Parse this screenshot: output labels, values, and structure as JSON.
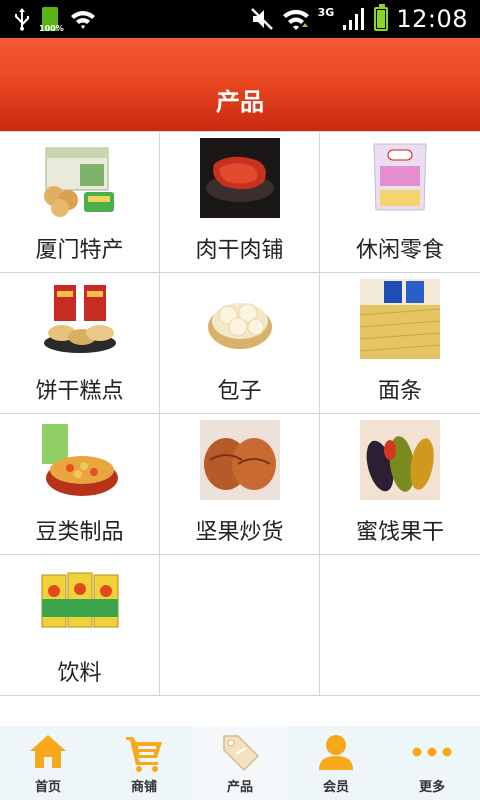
{
  "status_bar": {
    "time": "12:08",
    "battery_percent_label": "100%",
    "network_type": "3G"
  },
  "header": {
    "title": "产品"
  },
  "categories": [
    {
      "label": "厦门特产",
      "icon": "gift-box-image"
    },
    {
      "label": "肉干肉铺",
      "icon": "dried-meat-image"
    },
    {
      "label": "休闲零食",
      "icon": "snack-bag-image"
    },
    {
      "label": "饼干糕点",
      "icon": "pastry-image"
    },
    {
      "label": "包子",
      "icon": "steamed-bun-image"
    },
    {
      "label": "面条",
      "icon": "noodles-image"
    },
    {
      "label": "豆类制品",
      "icon": "bean-snack-image"
    },
    {
      "label": "坚果炒货",
      "icon": "nuts-image"
    },
    {
      "label": "蜜饯果干",
      "icon": "dried-fruit-image"
    },
    {
      "label": "饮料",
      "icon": "drink-cartons-image"
    }
  ],
  "bottom_nav": [
    {
      "label": "首页",
      "icon": "home-icon"
    },
    {
      "label": "商铺",
      "icon": "shopping-cart-icon"
    },
    {
      "label": "产品",
      "icon": "tag-icon",
      "active": true
    },
    {
      "label": "会员",
      "icon": "user-icon"
    },
    {
      "label": "更多",
      "icon": "more-dots-icon"
    }
  ],
  "colors": {
    "header_red": "#e8451f",
    "nav_orange": "#f7a81b"
  }
}
